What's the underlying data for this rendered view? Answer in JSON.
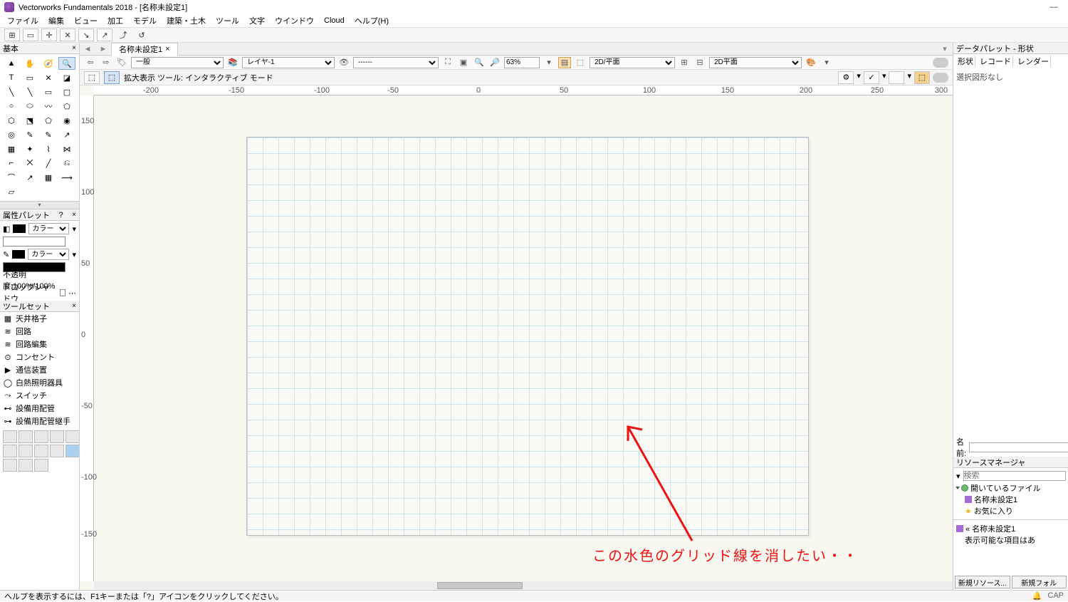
{
  "title": "Vectorworks Fundamentals 2018 - [名称未設定1]",
  "menu": [
    "ファイル",
    "編集",
    "ビュー",
    "加工",
    "モデル",
    "建築・土木",
    "ツール",
    "文字",
    "ウインドウ",
    "Cloud",
    "ヘルプ(H)"
  ],
  "basic_panel": "基本",
  "attr_panel": {
    "title": "属性パレット",
    "help": "?",
    "color_label": "カラー",
    "opacity": "不透明度:100%/100%",
    "shadow": "ドロップシャドウ"
  },
  "toolset": {
    "title": "ツールセット",
    "items": [
      "天井格子",
      "回路",
      "回路編集",
      "コンセント",
      "通信装置",
      "白熱照明器具",
      "スイッチ",
      "設備用配管",
      "設備用配管継手"
    ]
  },
  "doc_tab": "名称未設定1",
  "viewbar": {
    "class": "一般",
    "layer": "レイヤ-1",
    "zoom": "63%",
    "plane": "2D/平面",
    "view": "2D平面"
  },
  "modebar": {
    "tool": "拡大表示 ツール: インタラクティブ モード"
  },
  "ruler_h": [
    "-200",
    "-150",
    "-100",
    "-50",
    "0",
    "50",
    "100",
    "150",
    "200",
    "250",
    "300"
  ],
  "ruler_v": [
    "150",
    "100",
    "50",
    "0",
    "-50",
    "-100",
    "-150"
  ],
  "annotation": "この水色のグリッド線を消したい・・",
  "data_palette": {
    "title": "データパレット - 形状",
    "tabs": [
      "形状",
      "レコード",
      "レンダー"
    ],
    "empty": "選択図形なし",
    "name": "名前:"
  },
  "res_mgr": {
    "title": "リソースマネージャ",
    "search": "検索",
    "open_files": "開いているファイル",
    "file": "名称未設定1",
    "fav": "お気に入り",
    "current": "« 名称未設定1",
    "noitems": "表示可能な項目はあ",
    "btn1": "新規リソース...",
    "btn2": "新規フォル"
  },
  "status": {
    "help": "ヘルプを表示するには、F1キーまたは「?」アイコンをクリックしてください。",
    "cap": "CAP"
  }
}
